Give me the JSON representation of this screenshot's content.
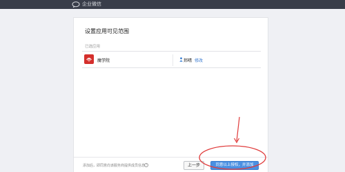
{
  "header": {
    "brand_text": "企业微信",
    "background_color": "#393d49"
  },
  "card": {
    "title": "设置应用可见范围",
    "selected_apps_label": "已选应用",
    "app": {
      "name": "魔学院",
      "icon_color": "#d42f2c"
    },
    "member": {
      "name": "邦晴",
      "edit_label": "修改"
    }
  },
  "footer": {
    "note": "添加后，即同意向该服务商提供成员信息",
    "help_icon": "help-icon",
    "prev_button": "上一步",
    "agree_button": "同意以上授权，并添加"
  },
  "annotation": {
    "color": "#e03a3a"
  }
}
